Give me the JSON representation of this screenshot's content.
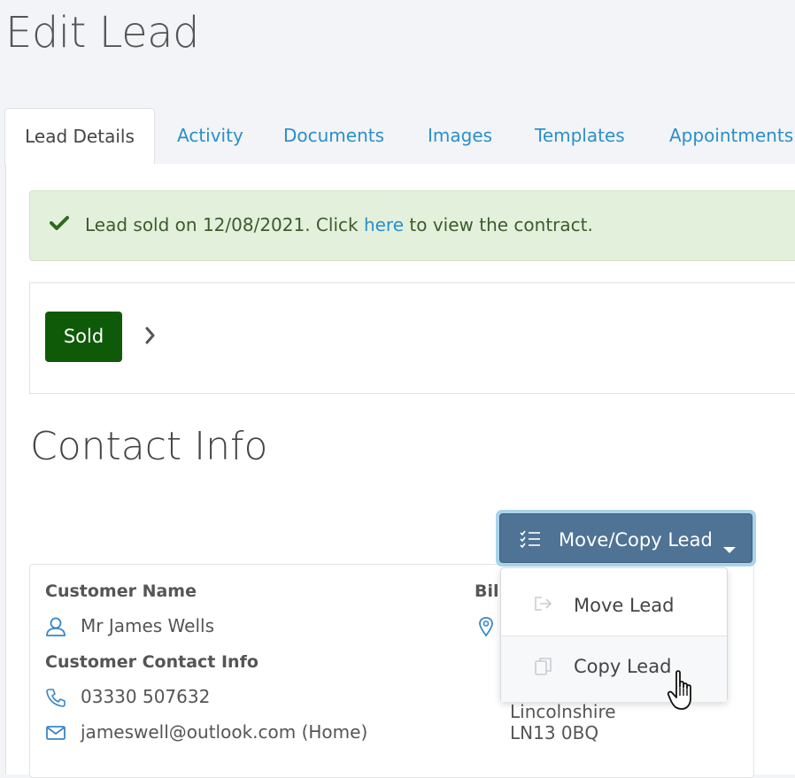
{
  "page": {
    "title": "Edit Lead"
  },
  "tabs": [
    {
      "label": "Lead Details",
      "active": true
    },
    {
      "label": "Activity"
    },
    {
      "label": "Documents"
    },
    {
      "label": "Images"
    },
    {
      "label": "Templates"
    },
    {
      "label": "Appointments"
    }
  ],
  "alert": {
    "prefix": "Lead sold on 12/08/2021. Click ",
    "link": "here",
    "suffix": " to view the contract.",
    "icon": "check-icon"
  },
  "status": {
    "badge": "Sold",
    "badge_color": "#0f5a08"
  },
  "contact": {
    "section_title": "Contact Info",
    "customer_name_label": "Customer Name",
    "customer_name": "Mr James Wells",
    "contact_info_label": "Customer Contact Info",
    "phone": "03330 507632",
    "email": "jameswell@outlook.com (Home)",
    "billing_label_partial": "Bill",
    "address_line_county": "Lincolnshire",
    "address_line_postcode": "LN13 0BQ"
  },
  "move_copy": {
    "button_label": "Move/Copy Lead",
    "items": [
      {
        "label": "Move Lead",
        "icon": "move-icon"
      },
      {
        "label": "Copy Lead",
        "icon": "copy-icon"
      }
    ]
  },
  "colors": {
    "accent_link": "#2a8fc9",
    "button_bg": "#4f7395",
    "alert_bg": "#e3f1dc"
  }
}
